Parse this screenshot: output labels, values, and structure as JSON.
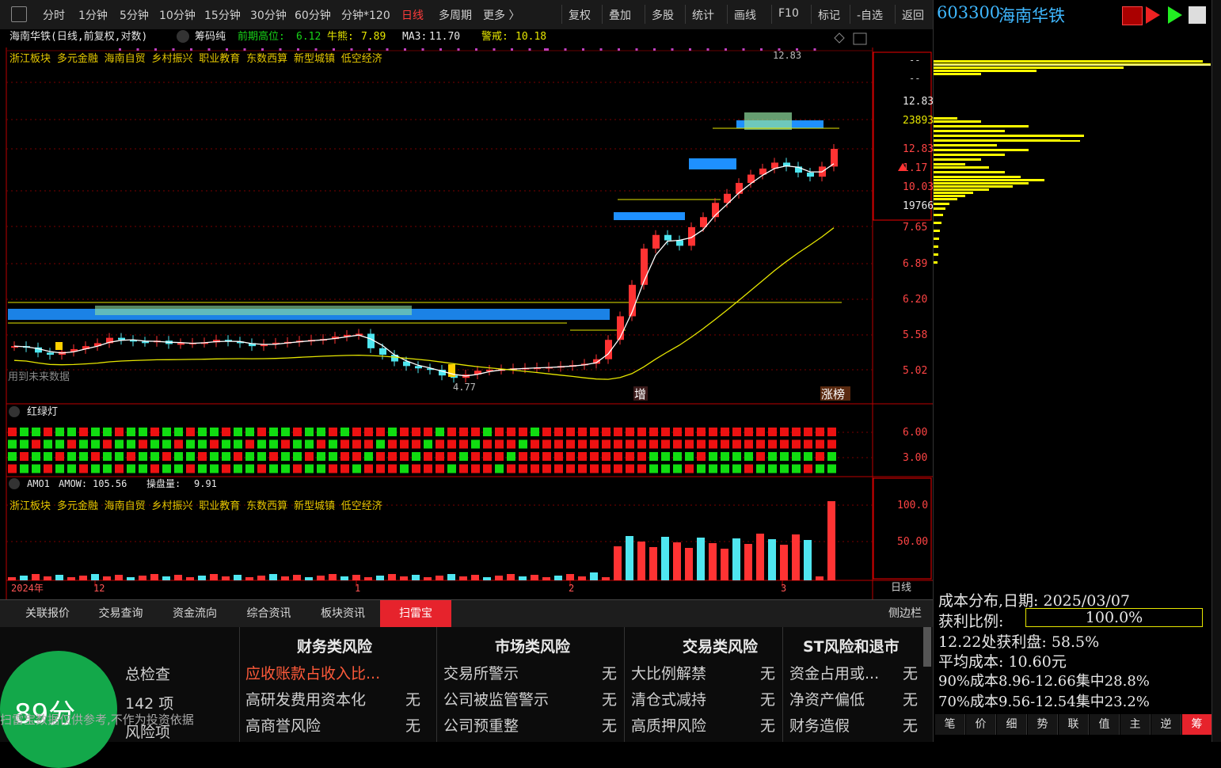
{
  "toolbar": {
    "periods": [
      "分时",
      "1分钟",
      "5分钟",
      "10分钟",
      "15分钟",
      "30分钟",
      "60分钟",
      "分钟*120",
      "日线",
      "多周期",
      "更多 〉"
    ],
    "active_period": "日线",
    "actions": [
      "复权",
      "叠加",
      "多股",
      "统计",
      "画线",
      "F10",
      "标记",
      "-自选",
      "返回"
    ]
  },
  "chart_header": {
    "title": "海南华铁(日线,前复权,对数)",
    "indicator": "筹码纯",
    "prev_high_label": "前期高位:",
    "prev_high": "6.12",
    "bull_label": "牛熊:",
    "bull": "7.89",
    "ma3_label": "MA3:",
    "ma3": "11.70",
    "alert_label": "警戒:",
    "alert": "10.18",
    "concepts": "浙江板块  多元金融  海南自贸  乡村振兴  职业教育  东数西算  新型城镇  低空经济",
    "future_note": "用到未来数据",
    "high_label": "12.83",
    "low_label": "4.77",
    "tag_zeng": "增",
    "tag_zhangbang": "涨榜"
  },
  "price_axis": {
    "labels": [
      "12.83",
      "23893",
      "12.83",
      "1.17",
      "10.03%",
      "19766",
      "7.65",
      "6.89",
      "6.20",
      "5.58",
      "5.02"
    ],
    "dash1": "--",
    "dash2": "--"
  },
  "redgreen": {
    "title": "红绿灯",
    "axis": [
      "6.00",
      "3.00"
    ]
  },
  "amo": {
    "name": "AMO1",
    "amow_label": "AMOW:",
    "amow": "105.56",
    "ctrl_label": "操盘量:",
    "ctrl": "9.91",
    "axis": [
      "100.0",
      "50.00"
    ]
  },
  "date_axis": {
    "labels": [
      "2024年",
      "12",
      "1",
      "2",
      "3"
    ],
    "period": "日线"
  },
  "tabs": [
    "关联报价",
    "交易查询",
    "资金流向",
    "综合资讯",
    "板块资讯",
    "扫雷宝"
  ],
  "tabs_active": "扫雷宝",
  "sidebar_label": "侧边栏",
  "scan": {
    "score": "89分",
    "total_label": "总检查",
    "total_count": "142 项",
    "risk_label": "风险项",
    "disclaimer": "扫雷宝数据仅供参考,不作为投资依据",
    "col1": {
      "title": "财务类风险",
      "items": [
        {
          "name": "应收账款占收入比...",
          "val": ""
        },
        {
          "name": "高研发费用资本化",
          "val": "无"
        },
        {
          "name": "高商誉风险",
          "val": "无"
        }
      ]
    },
    "col2": {
      "title": "市场类风险",
      "items": [
        {
          "name": "交易所警示",
          "val": "无"
        },
        {
          "name": "公司被监管警示",
          "val": "无"
        },
        {
          "name": "公司预重整",
          "val": "无"
        }
      ]
    },
    "col3": {
      "title": "交易类风险",
      "items": [
        {
          "name": "大比例解禁",
          "val": "无"
        },
        {
          "name": "清仓式减持",
          "val": "无"
        },
        {
          "name": "高质押风险",
          "val": "无"
        }
      ]
    },
    "col4": {
      "title": "ST风险和退市",
      "items": [
        {
          "name": "资金占用或...",
          "val": "无"
        },
        {
          "name": "净资产偏低",
          "val": "无"
        },
        {
          "name": "财务造假",
          "val": "无"
        }
      ]
    }
  },
  "right_panel": {
    "code": "603300",
    "name": "海南华铁",
    "cost_date": "成本分布,日期: 2025/03/07",
    "profit_label": "获利比例:",
    "profit_value": "100.0%",
    "line1": "12.22处获利盘: 58.5%",
    "line2": "平均成本:  10.60元",
    "line3": "90%成本8.96-12.66集中28.8%",
    "line4": "70%成本9.56-12.54集中23.2%",
    "tabs": [
      "笔",
      "价",
      "细",
      "势",
      "联",
      "值",
      "主",
      "逆",
      "筹"
    ],
    "tab_active": "筹"
  },
  "colors": {
    "up": "#ff3333",
    "down": "#4fe6f0",
    "ma_white": "#ffffff",
    "ma_yellow": "#e6e600",
    "chip_blue": "#1e90ff",
    "accent": "#e6232c"
  }
}
